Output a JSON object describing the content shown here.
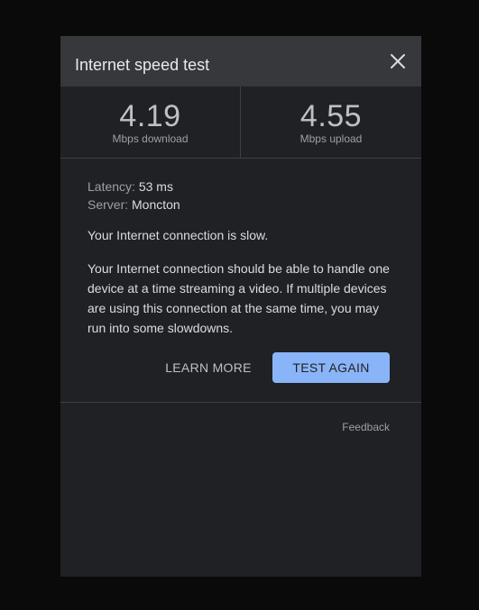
{
  "dialog": {
    "title": "Internet speed test",
    "close_icon": "close-icon"
  },
  "stats": {
    "download": {
      "value": "4.19",
      "label": "Mbps download"
    },
    "upload": {
      "value": "4.55",
      "label": "Mbps upload"
    }
  },
  "details": {
    "latency_key": "Latency:",
    "latency_value": "53 ms",
    "server_key": "Server:",
    "server_value": "Moncton"
  },
  "status_text": "Your Internet connection is slow.",
  "description": "Your Internet connection should be able to handle one device at a time streaming a video. If multiple devices are using this connection at the same time, you may run into some slowdowns.",
  "actions": {
    "learn_more": "LEARN MORE",
    "test_again": "TEST AGAIN"
  },
  "footer": {
    "feedback": "Feedback"
  },
  "colors": {
    "background": "#0a0a0a",
    "dialog": "#202124",
    "header": "#36383b",
    "accent": "#8ab4f8"
  }
}
